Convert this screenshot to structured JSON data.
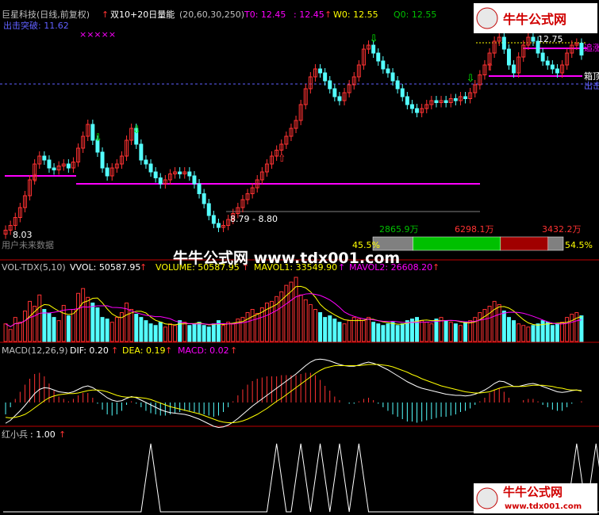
{
  "colors": {
    "background": "#000000",
    "up": "#ff3232",
    "down": "#54ffff",
    "separator": "#c00000",
    "magenta": "#ff00ff",
    "yellow": "#ffff00",
    "white": "#ffffff",
    "gray": "#808080",
    "green": "#00c000",
    "darkred": "#a00000"
  },
  "header": {
    "title": "巨星科技(日线,前复权)",
    "indicator": "双10+20日量能",
    "params": "(20,60,30,250)",
    "t0": "T0: 12.45",
    "t1": ": 12.45",
    "w0": "W0: 12.55",
    "q0": "Q0: 12.55",
    "exit_label": "出击突破: 11.62"
  },
  "price_panel": {
    "high_label": "12.75",
    "low_label": "8.03",
    "range_label": "8.79 - 8.80",
    "future_label": "用户未来数据",
    "right_tag_1": "追涨",
    "right_tag_2": "箱顶",
    "right_tag_3": "出击",
    "x_marks": "×××××",
    "vol_dist": {
      "left_value": "2865.9万",
      "mid_value": "6298.1万",
      "right_value": "3432.2万",
      "left_pct": "45.5%",
      "right_pct": "54.5%",
      "shares": [
        0.21,
        0.46,
        0.25,
        0.08
      ]
    }
  },
  "watermark": {
    "main": "牛牛公式网 www.tdx001.com",
    "corner_top": "牛牛公式网",
    "corner_bottom": "牛牛公式网",
    "corner_url": "www.tdx001.com"
  },
  "volume_panel": {
    "name": "VOL-TDX(5,10)",
    "vvol": "VVOL: 50587.95",
    "volume": "VOLUME: 50587.95",
    "mavol1": "MAVOL1: 33549.90",
    "mavol2": "MAVOL2: 26608.20"
  },
  "macd_panel": {
    "name": "MACD(12,26,9)",
    "dif": "DIF: 0.20",
    "dea": "DEA: 0.19",
    "macd": "MACD: 0.02"
  },
  "signal_panel": {
    "name": "红小兵",
    "value": ": 1.00"
  },
  "chart_data": {
    "type": "candlestick",
    "x_count": 120,
    "price_range": [
      7.8,
      13.0
    ],
    "levels": {
      "box_top_1": 9.97,
      "support": 8.8,
      "box_top_2": 11.95,
      "exit_line": 11.62
    },
    "candles_close": [
      8.03,
      8.15,
      8.35,
      8.6,
      8.9,
      9.3,
      9.7,
      9.9,
      9.8,
      9.6,
      9.55,
      9.65,
      9.7,
      9.6,
      9.75,
      10.1,
      10.4,
      10.7,
      10.3,
      10.0,
      9.6,
      9.4,
      9.6,
      9.7,
      9.9,
      10.3,
      10.6,
      10.2,
      9.8,
      9.7,
      9.5,
      9.35,
      9.2,
      9.3,
      9.45,
      9.5,
      9.45,
      9.5,
      9.4,
      9.2,
      8.95,
      8.7,
      8.4,
      8.2,
      8.1,
      8.15,
      8.3,
      8.45,
      8.6,
      8.8,
      8.95,
      9.1,
      9.3,
      9.5,
      9.7,
      9.9,
      10.05,
      10.2,
      10.4,
      10.6,
      10.8,
      11.2,
      11.6,
      11.9,
      12.1,
      12.0,
      11.8,
      11.6,
      11.4,
      11.3,
      11.5,
      11.7,
      11.9,
      12.2,
      12.6,
      12.7,
      12.5,
      12.3,
      12.1,
      12.0,
      11.8,
      11.6,
      11.4,
      11.2,
      11.1,
      11.0,
      11.1,
      11.2,
      11.3,
      11.25,
      11.3,
      11.25,
      11.35,
      11.3,
      11.4,
      11.35,
      11.5,
      11.7,
      11.95,
      12.2,
      12.5,
      12.8,
      12.9,
      12.6,
      12.2,
      12.0,
      12.4,
      12.7,
      12.9,
      12.8,
      12.5,
      12.3,
      12.2,
      12.1,
      12.0,
      12.2,
      12.5,
      12.7,
      12.75,
      12.45
    ],
    "volume_values": [
      22,
      15,
      30,
      24,
      38,
      50,
      44,
      58,
      40,
      35,
      30,
      26,
      45,
      32,
      40,
      60,
      66,
      55,
      48,
      42,
      30,
      28,
      24,
      30,
      36,
      48,
      40,
      34,
      30,
      26,
      22,
      20,
      24,
      18,
      22,
      20,
      26,
      24,
      20,
      22,
      24,
      20,
      18,
      22,
      26,
      20,
      24,
      22,
      28,
      30,
      36,
      40,
      35,
      42,
      48,
      50,
      56,
      62,
      70,
      74,
      80,
      58,
      52,
      46,
      40,
      36,
      30,
      32,
      28,
      24,
      22,
      26,
      30,
      28,
      26,
      30,
      24,
      22,
      20,
      22,
      24,
      20,
      22,
      26,
      28,
      30,
      26,
      24,
      22,
      28,
      30,
      26,
      24,
      22,
      20,
      24,
      26,
      30,
      36,
      40,
      44,
      50,
      46,
      38,
      30,
      26,
      22,
      20,
      18,
      20,
      22,
      26,
      24,
      20,
      22,
      24,
      30,
      34,
      36,
      32
    ],
    "macd_dif": [
      -0.35,
      -0.3,
      -0.22,
      -0.14,
      -0.05,
      0.05,
      0.15,
      0.22,
      0.25,
      0.24,
      0.21,
      0.18,
      0.17,
      0.16,
      0.18,
      0.22,
      0.26,
      0.28,
      0.25,
      0.2,
      0.14,
      0.08,
      0.04,
      0.02,
      0.03,
      0.07,
      0.1,
      0.08,
      0.04,
      0.0,
      -0.04,
      -0.08,
      -0.12,
      -0.15,
      -0.17,
      -0.18,
      -0.19,
      -0.2,
      -0.22,
      -0.25,
      -0.28,
      -0.32,
      -0.36,
      -0.4,
      -0.42,
      -0.41,
      -0.38,
      -0.33,
      -0.27,
      -0.2,
      -0.13,
      -0.06,
      0.0,
      0.06,
      0.12,
      0.18,
      0.24,
      0.3,
      0.36,
      0.42,
      0.48,
      0.55,
      0.62,
      0.68,
      0.72,
      0.73,
      0.72,
      0.7,
      0.67,
      0.64,
      0.62,
      0.61,
      0.61,
      0.63,
      0.66,
      0.68,
      0.66,
      0.63,
      0.59,
      0.55,
      0.5,
      0.45,
      0.4,
      0.35,
      0.31,
      0.27,
      0.24,
      0.22,
      0.2,
      0.18,
      0.16,
      0.14,
      0.13,
      0.12,
      0.12,
      0.11,
      0.12,
      0.14,
      0.17,
      0.21,
      0.26,
      0.32,
      0.36,
      0.35,
      0.31,
      0.27,
      0.27,
      0.29,
      0.31,
      0.32,
      0.3,
      0.27,
      0.24,
      0.21,
      0.18,
      0.17,
      0.18,
      0.2,
      0.21,
      0.2
    ],
    "macd_dea": [
      -0.25,
      -0.26,
      -0.25,
      -0.23,
      -0.2,
      -0.15,
      -0.09,
      -0.03,
      0.03,
      0.08,
      0.11,
      0.13,
      0.14,
      0.15,
      0.15,
      0.16,
      0.18,
      0.2,
      0.21,
      0.21,
      0.2,
      0.18,
      0.15,
      0.12,
      0.1,
      0.09,
      0.09,
      0.09,
      0.08,
      0.07,
      0.05,
      0.02,
      -0.01,
      -0.04,
      -0.07,
      -0.09,
      -0.11,
      -0.13,
      -0.15,
      -0.17,
      -0.19,
      -0.22,
      -0.25,
      -0.28,
      -0.31,
      -0.33,
      -0.34,
      -0.34,
      -0.33,
      -0.31,
      -0.28,
      -0.24,
      -0.2,
      -0.15,
      -0.1,
      -0.04,
      0.02,
      0.07,
      0.13,
      0.19,
      0.25,
      0.31,
      0.37,
      0.43,
      0.49,
      0.54,
      0.58,
      0.6,
      0.62,
      0.62,
      0.62,
      0.62,
      0.62,
      0.62,
      0.63,
      0.64,
      0.64,
      0.64,
      0.63,
      0.62,
      0.6,
      0.57,
      0.54,
      0.51,
      0.47,
      0.44,
      0.4,
      0.37,
      0.34,
      0.31,
      0.28,
      0.26,
      0.24,
      0.22,
      0.2,
      0.18,
      0.17,
      0.16,
      0.16,
      0.17,
      0.18,
      0.21,
      0.24,
      0.26,
      0.27,
      0.27,
      0.27,
      0.27,
      0.28,
      0.29,
      0.29,
      0.29,
      0.28,
      0.27,
      0.25,
      0.24,
      0.22,
      0.21,
      0.21,
      0.19
    ],
    "signal_spikes": [
      30,
      56,
      61,
      65,
      69,
      73,
      118,
      122
    ]
  }
}
